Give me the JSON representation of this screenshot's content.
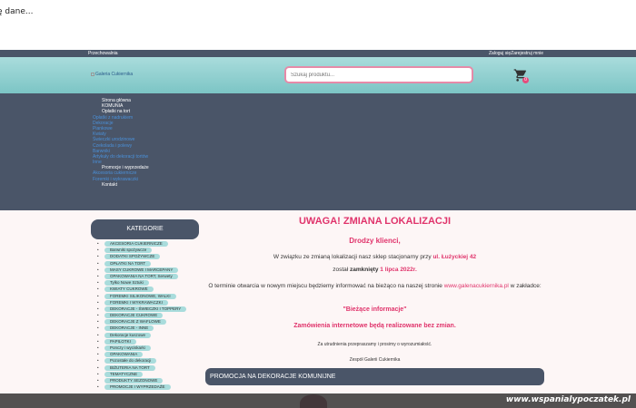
{
  "loading_text": "ę dane...",
  "topbar": {
    "store": "Przechowalnia",
    "account": "Zaloguj sięZarejestruj mnie"
  },
  "header": {
    "logo_alt": "Galeria Cukiernika",
    "search_placeholder": "Szukaj produktu...",
    "cart_count": "0"
  },
  "nav": {
    "items": [
      {
        "label": "Strona główna",
        "style": "w"
      },
      {
        "label": "KOMUNIA",
        "style": "w"
      },
      {
        "label": "Opłatki na tort",
        "style": "w"
      },
      {
        "label": "Opłatki z nadrukiem",
        "style": "b"
      },
      {
        "label": "Dekoracje",
        "style": "b"
      },
      {
        "label": "Piankowe",
        "style": "b"
      },
      {
        "label": "Kwiaty",
        "style": "b"
      },
      {
        "label": "Świeczki urodzinowe",
        "style": "b"
      },
      {
        "label": "Czekolada i polewy",
        "style": "b"
      },
      {
        "label": "Barwniki",
        "style": "b"
      },
      {
        "label": "Artykuły do dekoracji tortów",
        "style": "b"
      },
      {
        "label": "Inne",
        "style": "b"
      },
      {
        "label": "Promocje i wyprzedaże",
        "style": "w"
      },
      {
        "label": "Akcesoria cukiernicze",
        "style": "b"
      },
      {
        "label": "Foremki i wykrawaczki",
        "style": "b"
      },
      {
        "label": "Kontakt",
        "style": "w"
      }
    ]
  },
  "categories": {
    "title": "KATEGORIE",
    "items": [
      "AKCESORIA CUKIERNICZE",
      "Barwniki spożywcze",
      "DODATKI SPOŻYWCZE",
      "OPŁATKI NA TORT",
      "MASY CUKROWE I MARCEPANY",
      "OPAKOWANIA NA TORT, Serwety",
      "Tylko Nowe Sztuki",
      "KWIATY CUKROWE",
      "FOREMKI SILIKONOWE, WALKI",
      "FOREMKI I WYKRAWACZKI",
      "DEKORACJE - ŚWIECZKI I TOPPERY",
      "DEKORACJE CUKROWE",
      "DEKORACJE Z WAFLOWE",
      "DEKORACJE - INNE",
      "Dekoracje kuszowe",
      "PAPILOTKI",
      "Ponczy i wyciskarki",
      "OPAKOWANIA",
      "Pozostałe do dekoracji",
      "BIŻUTERIA NA TORT",
      "TEMATYCZNE",
      "PRODUKTY SEZONOWE",
      "PROMOCJE I WYPRZEDAŻE"
    ]
  },
  "announcement": {
    "title": "UWAGA! ZMIANA LOKALIZACJI",
    "greeting": "Drodzy klienci,",
    "line1_pre": "W związku ze zmianą lokalizacji nasz sklep stacjonarny przy ",
    "line1_street": "ul. Łużyckiej 42",
    "line2_pre": "został ",
    "line2_bold": "zamknięty",
    "line2_date": "1 lipca 2022r.",
    "line3_pre": "O terminie otwarcia w nowym miejscu będziemy informować na bieżąco na naszej stronie ",
    "line3_link": "www.galenacukiernika.pl",
    "line3_post": " w zakładce:",
    "quote": "\"Bieżące informacje\"",
    "orders": "Zamówienia internetowe będą realizowane bez zmian.",
    "apology": "Za utrudnienia przepraszamy i prosimy o wyrozumiałość.",
    "signature": "Zespół Galerii Cukiernika"
  },
  "promo_bar": "PROMOCJA NA DEKORACJE KOMUNIJNE",
  "watermark": "www.wspanialypoczatek.pl",
  "colors": {
    "accent": "#e0336b",
    "dark": "#4a5568",
    "teal": "#a9dcdc"
  }
}
